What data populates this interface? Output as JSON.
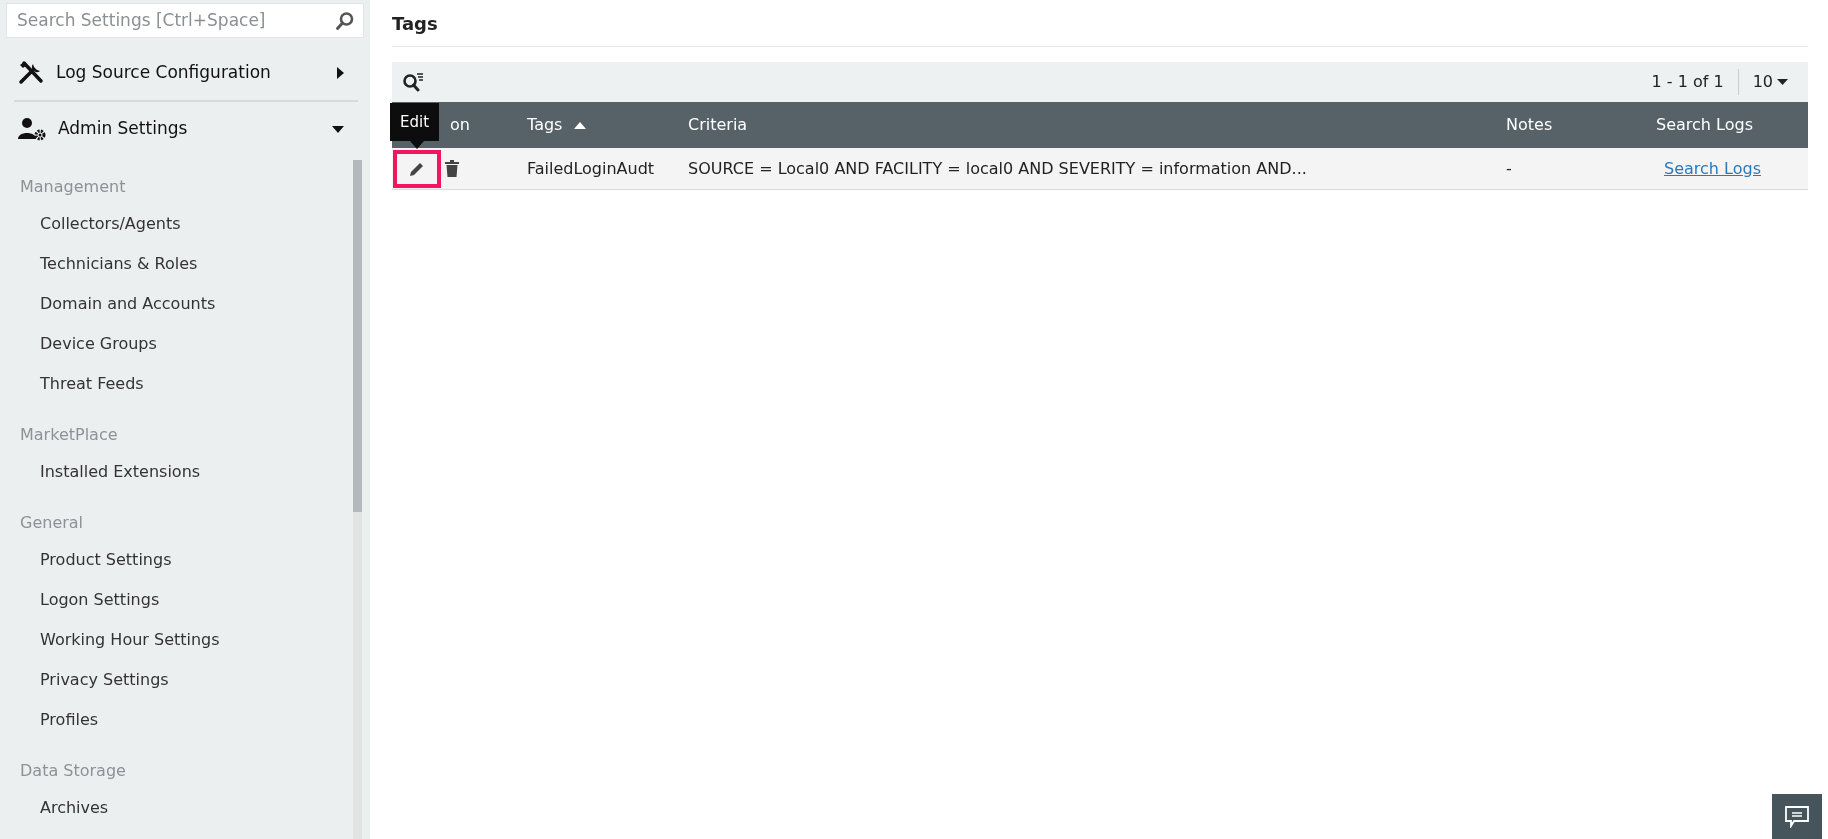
{
  "sidebar": {
    "search": {
      "placeholder": "Search Settings [Ctrl+Space]"
    },
    "menus": [
      {
        "label": "Log Source Configuration",
        "kind": "tools",
        "expanded": false
      },
      {
        "label": "Admin Settings",
        "kind": "admin",
        "expanded": true
      }
    ],
    "groups": [
      {
        "title": "Management",
        "items": [
          "Collectors/Agents",
          "Technicians & Roles",
          "Domain and Accounts",
          "Device Groups",
          "Threat Feeds"
        ]
      },
      {
        "title": "MarketPlace",
        "items": [
          "Installed Extensions"
        ]
      },
      {
        "title": "General",
        "items": [
          "Product Settings",
          "Logon Settings",
          "Working Hour Settings",
          "Privacy Settings",
          "Profiles"
        ]
      },
      {
        "title": "Data Storage",
        "items": [
          "Archives"
        ]
      }
    ]
  },
  "page": {
    "title": "Tags"
  },
  "pager": {
    "range": "1 - 1 of 1",
    "page_size": "10"
  },
  "table": {
    "columns": [
      {
        "label": "on",
        "sorted": false
      },
      {
        "label": "Tags",
        "sorted": true
      },
      {
        "label": "Criteria",
        "sorted": false
      },
      {
        "label": "Notes",
        "sorted": false
      },
      {
        "label": "Search Logs",
        "sorted": false
      }
    ],
    "rows": [
      {
        "tag": "FailedLoginAudt",
        "criteria": "SOURCE = Local0 AND FACILITY = local0 AND SEVERITY = information AND...",
        "notes": "-",
        "link": "Search Logs",
        "edit_highlighted": true
      }
    ]
  },
  "tooltip": {
    "text": "Edit"
  }
}
